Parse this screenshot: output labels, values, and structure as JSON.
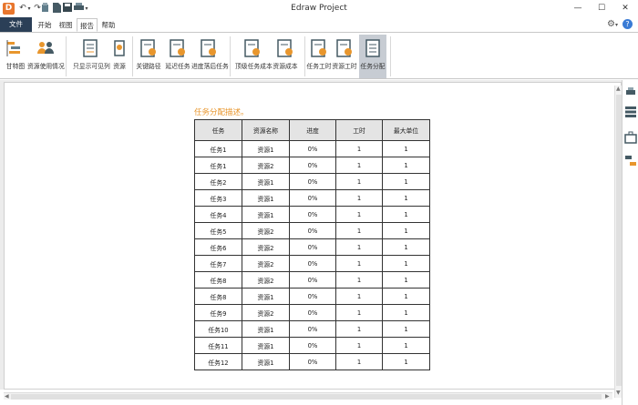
{
  "window": {
    "title": "Edraw Project",
    "logo_text": "D",
    "minimize": "—",
    "maximize": "☐",
    "close": "✕"
  },
  "quick_access": [
    "↶",
    "▾",
    "↷",
    "▾",
    "▾",
    "▾"
  ],
  "tabs": [
    "文件",
    "开始",
    "视图",
    "报告",
    "帮助"
  ],
  "active_tab": "报告",
  "ribbon": {
    "buttons": [
      {
        "label": "甘特图",
        "icon": "gantt-icon"
      },
      {
        "label": "资源使用情况",
        "icon": "resource-usage-icon"
      },
      {
        "label": "只显示可见列",
        "icon": "visible-columns-icon"
      },
      {
        "label": "资源",
        "icon": "resource-icon"
      },
      {
        "label": "关键路径",
        "icon": "critical-path-icon"
      },
      {
        "label": "延迟任务",
        "icon": "delayed-task-icon"
      },
      {
        "label": "进度落后任务",
        "icon": "behind-schedule-icon"
      },
      {
        "label": "顶级任务成本",
        "icon": "top-task-cost-icon"
      },
      {
        "label": "资源成本",
        "icon": "resource-cost-icon"
      },
      {
        "label": "任务工时",
        "icon": "task-hours-icon"
      },
      {
        "label": "资源工时",
        "icon": "resource-hours-icon"
      },
      {
        "label": "任务分配",
        "icon": "task-assignment-icon"
      }
    ]
  },
  "report": {
    "title": "任务分配描述。",
    "columns": [
      "任务",
      "资源名称",
      "进度",
      "工时",
      "最大单位"
    ],
    "rows": [
      [
        "任务1",
        "资源1",
        "0%",
        "1",
        "1"
      ],
      [
        "任务1",
        "资源2",
        "0%",
        "1",
        "1"
      ],
      [
        "任务2",
        "资源1",
        "0%",
        "1",
        "1"
      ],
      [
        "任务3",
        "资源1",
        "0%",
        "1",
        "1"
      ],
      [
        "任务4",
        "资源1",
        "0%",
        "1",
        "1"
      ],
      [
        "任务5",
        "资源2",
        "0%",
        "1",
        "1"
      ],
      [
        "任务6",
        "资源2",
        "0%",
        "1",
        "1"
      ],
      [
        "任务7",
        "资源2",
        "0%",
        "1",
        "1"
      ],
      [
        "任务8",
        "资源2",
        "0%",
        "1",
        "1"
      ],
      [
        "任务8",
        "资源1",
        "0%",
        "1",
        "1"
      ],
      [
        "任务9",
        "资源2",
        "0%",
        "1",
        "1"
      ],
      [
        "任务10",
        "资源1",
        "0%",
        "1",
        "1"
      ],
      [
        "任务11",
        "资源1",
        "0%",
        "1",
        "1"
      ],
      [
        "任务12",
        "资源1",
        "0%",
        "1",
        "1"
      ]
    ]
  },
  "colors": {
    "accent": "#e8962d",
    "file_tab": "#2b3f57",
    "active_button": "#c7ccd3"
  },
  "right_panel": [
    "print-icon",
    "list-panel-icon",
    "bag-icon",
    "task-panel-icon"
  ]
}
